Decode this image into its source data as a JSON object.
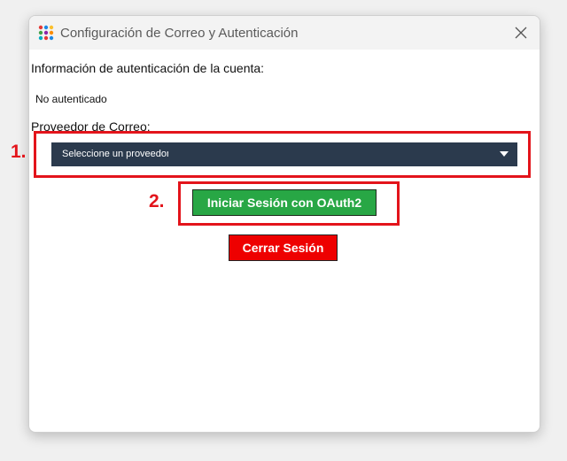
{
  "window": {
    "title": "Configuración de Correo y Autenticación",
    "app_icon": "colored-dots-grid-icon",
    "close_icon": "close-icon"
  },
  "auth": {
    "heading": "Información de autenticación de la cuenta:",
    "status": "No autenticado"
  },
  "provider": {
    "label": "Proveedor de Correo:",
    "selected": "Seleccione un proveedor",
    "caret_icon": "chevron-down-icon"
  },
  "buttons": {
    "login": "Iniciar Sesión con OAuth2",
    "logout": "Cerrar Sesión"
  },
  "annotations": {
    "step1": "1.",
    "step2": "2.",
    "color": "#e3141b"
  },
  "colors": {
    "select_bg": "#2b3a4d",
    "login_bg": "#28a745",
    "logout_bg": "#ee0000"
  }
}
